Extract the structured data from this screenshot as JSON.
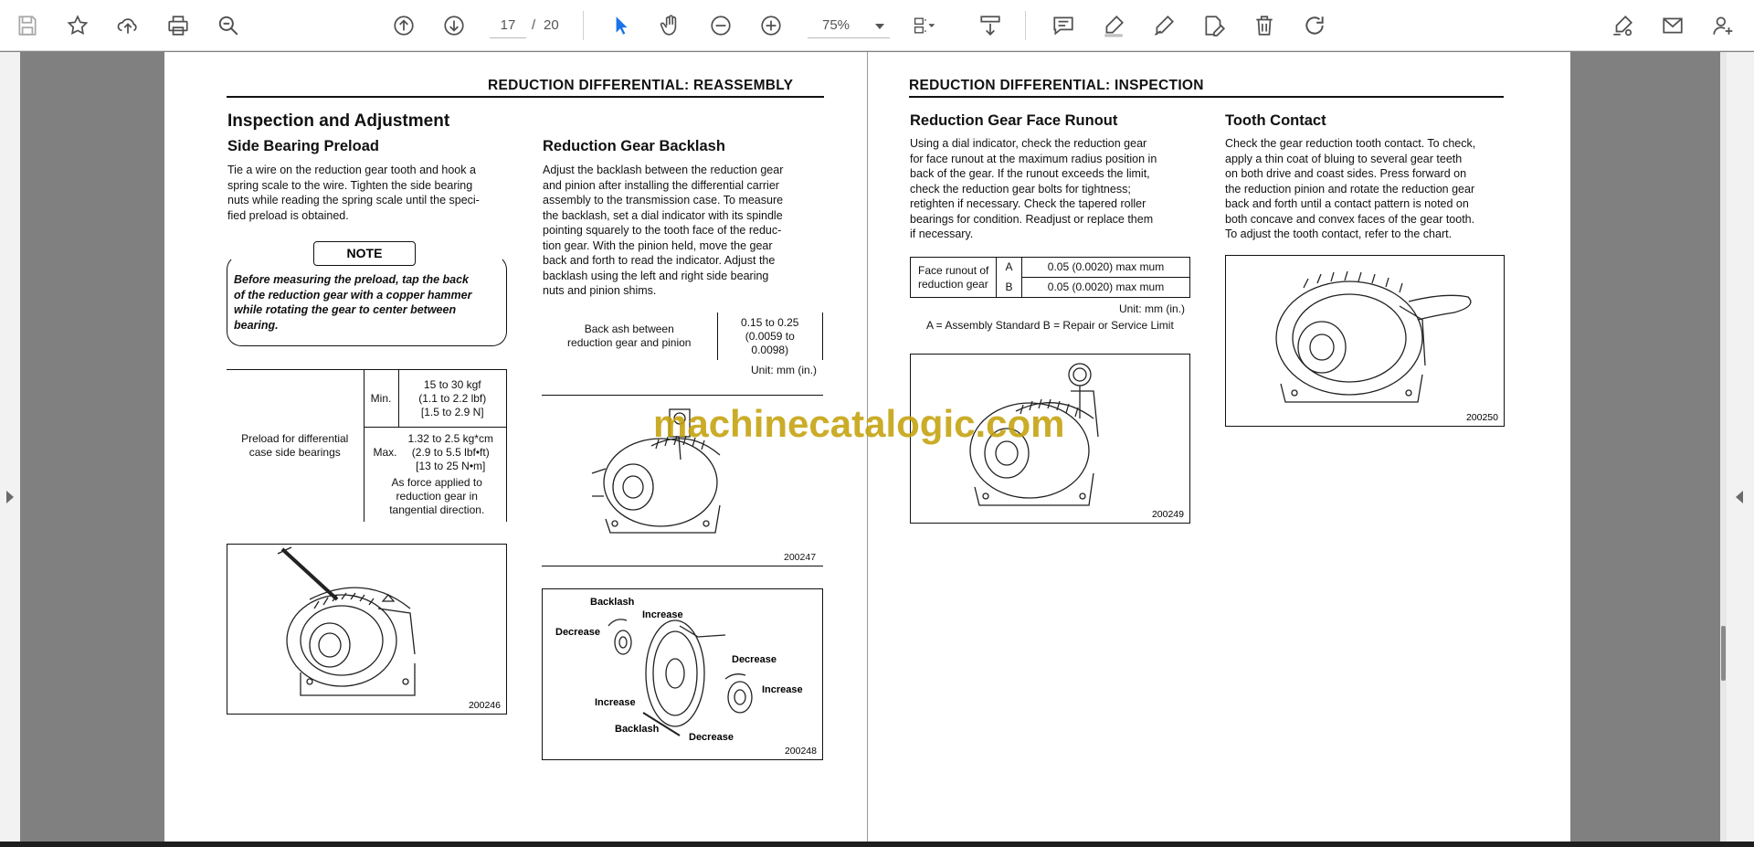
{
  "toolbar": {
    "page_current": "17",
    "page_separator": "/",
    "page_total": "20",
    "zoom": "75%"
  },
  "left_page": {
    "header": "REDUCTION DIFFERENTIAL: REASSEMBLY",
    "heading": "Inspection and Adjustment",
    "side_bearing": {
      "title": "Side Bearing Preload",
      "lines": [
        "Tie a wire on the reduction gear tooth and hook a",
        "spring scale to the wire. Tighten the side bearing",
        "nuts while reading the spring scale until the speci-",
        "fied preload is obtained."
      ],
      "note_title": "NOTE",
      "note_lines": [
        "Before measuring the preload, tap the back",
        "of the reduction gear with a copper hammer",
        "while rotating the gear to center between",
        "bearing."
      ],
      "table": {
        "label_lines": [
          "Preload for differential",
          "case side bearings"
        ],
        "min_label": "Min.",
        "min_lines": [
          "15 to 30 kgf",
          "(1.1 to 2.2 lbf)",
          "[1.5 to 2.9 N]"
        ],
        "max_label": "Max.",
        "max_lines": [
          "1.32 to 2.5 kg*cm",
          "(2.9 to 5.5 lbf•ft)",
          "[13 to 25 N•m]"
        ],
        "force_lines": [
          "As force applied to",
          "reduction gear in",
          "tangential direction."
        ]
      },
      "figure_number": "200246"
    },
    "backlash": {
      "title": "Reduction Gear Backlash",
      "lines": [
        "Adjust the backlash between the reduction gear",
        "and pinion after installing the differential carrier",
        "assembly to the transmission case. To measure",
        "the backlash, set a dial indicator with its spindle",
        "pointing squarely to the tooth face of the reduc-",
        "tion gear. With the pinion held, move the gear",
        "back and forth to read the indicator. Adjust the",
        "backlash using the left and right side bearing",
        "nuts and pinion shims."
      ],
      "table": {
        "label_lines": [
          "Back ash between",
          "reduction gear and pinion"
        ],
        "value_lines": [
          "0.15 to 0.25",
          "(0.0059 to",
          "0.0098)"
        ],
        "unit": "Unit: mm (in.)"
      },
      "figure_1_number": "200247",
      "figure_2": {
        "number": "200248",
        "labels": {
          "backlash_top": "Backlash",
          "increase_top": "Increase",
          "decrease_left": "Decrease",
          "decrease_right": "Decrease",
          "increase_right": "Increase",
          "increase_bottom": "Increase",
          "backlash_bottom": "Backlash",
          "decrease_bottom": "Decrease"
        }
      }
    }
  },
  "right_page": {
    "header": "REDUCTION DIFFERENTIAL: INSPECTION",
    "runout": {
      "title": "Reduction Gear Face Runout",
      "lines": [
        "Using a dial indicator, check the reduction gear",
        "for face runout at the maximum radius position in",
        "back of the gear. If the runout exceeds the limit,",
        "check the reduction gear bolts for tightness;",
        "retighten if necessary. Check the tapered roller",
        "bearings for condition. Readjust or replace them",
        "if necessary."
      ],
      "table": {
        "label_lines": [
          "Face runout of",
          "reduction gear"
        ],
        "row_a_label": "A",
        "row_a_value": "0.05 (0.0020) max mum",
        "row_b_label": "B",
        "row_b_value": "0.05 (0.0020) max mum",
        "unit": "Unit: mm (in.)",
        "legend": "A = Assembly Standard  B = Repair or Service Limit"
      },
      "figure_number": "200249"
    },
    "tooth": {
      "title": "Tooth Contact",
      "lines": [
        "Check the gear reduction tooth contact. To check,",
        "apply a thin coat of bluing to several gear teeth",
        "on both drive and coast sides. Press forward on",
        "the reduction pinion and rotate the reduction gear",
        "back and forth until a contact pattern is noted on",
        "both concave and convex faces of the gear tooth.",
        "To adjust the tooth contact, refer to the chart."
      ],
      "figure_number": "200250"
    }
  },
  "watermark": "machinecatalogic.com",
  "colors": {
    "accent_cursor": "#1a73e8",
    "watermark": "#c4a00a"
  },
  "icons": [
    "save-icon",
    "bookmark-star-icon",
    "upload-icon",
    "print-icon",
    "zoom-search-icon",
    "page-up-icon",
    "page-down-icon",
    "select-cursor-icon",
    "hand-pan-icon",
    "zoom-out-icon",
    "zoom-in-icon",
    "page-fit-icon",
    "scroll-mode-icon",
    "comment-icon",
    "highlight-pen-icon",
    "draw-icon",
    "edit-text-icon",
    "delete-icon",
    "redo-icon",
    "sign-icon",
    "email-icon",
    "add-user-icon"
  ]
}
